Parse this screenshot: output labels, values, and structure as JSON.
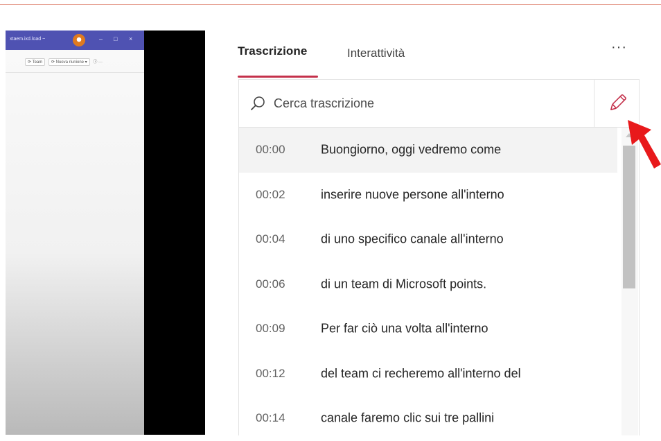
{
  "video": {
    "inner_title": "xtaem.ixd.load ~",
    "inner_controls": [
      "–",
      "□",
      "×"
    ],
    "inner_toolbar": [
      "⟳ Team",
      "⟳ Nuova riunione ▾",
      "ⓘ",
      "···"
    ]
  },
  "tabs": [
    {
      "label": "Trascrizione",
      "active": true
    },
    {
      "label": "Interattività",
      "active": false
    }
  ],
  "more_button_label": "···",
  "search": {
    "placeholder": "Cerca trascrizione",
    "value": ""
  },
  "edit_button": {
    "icon": "pencil-icon"
  },
  "transcript": [
    {
      "time": "00:00",
      "text": "Buongiorno, oggi vedremo come"
    },
    {
      "time": "00:02",
      "text": "inserire nuove persone all'interno"
    },
    {
      "time": "00:04",
      "text": "di uno specifico canale all'interno"
    },
    {
      "time": "00:06",
      "text": "di un team di Microsoft points."
    },
    {
      "time": "00:09",
      "text": "Per far ciò una volta all'interno"
    },
    {
      "time": "00:12",
      "text": "del team ci recheremo all'interno del"
    },
    {
      "time": "00:14",
      "text": "canale faremo clic sui tre pallini"
    }
  ],
  "colors": {
    "accent": "#c4314b",
    "annotation_arrow": "#e8191b",
    "inner_titlebar": "#4f52b2"
  }
}
